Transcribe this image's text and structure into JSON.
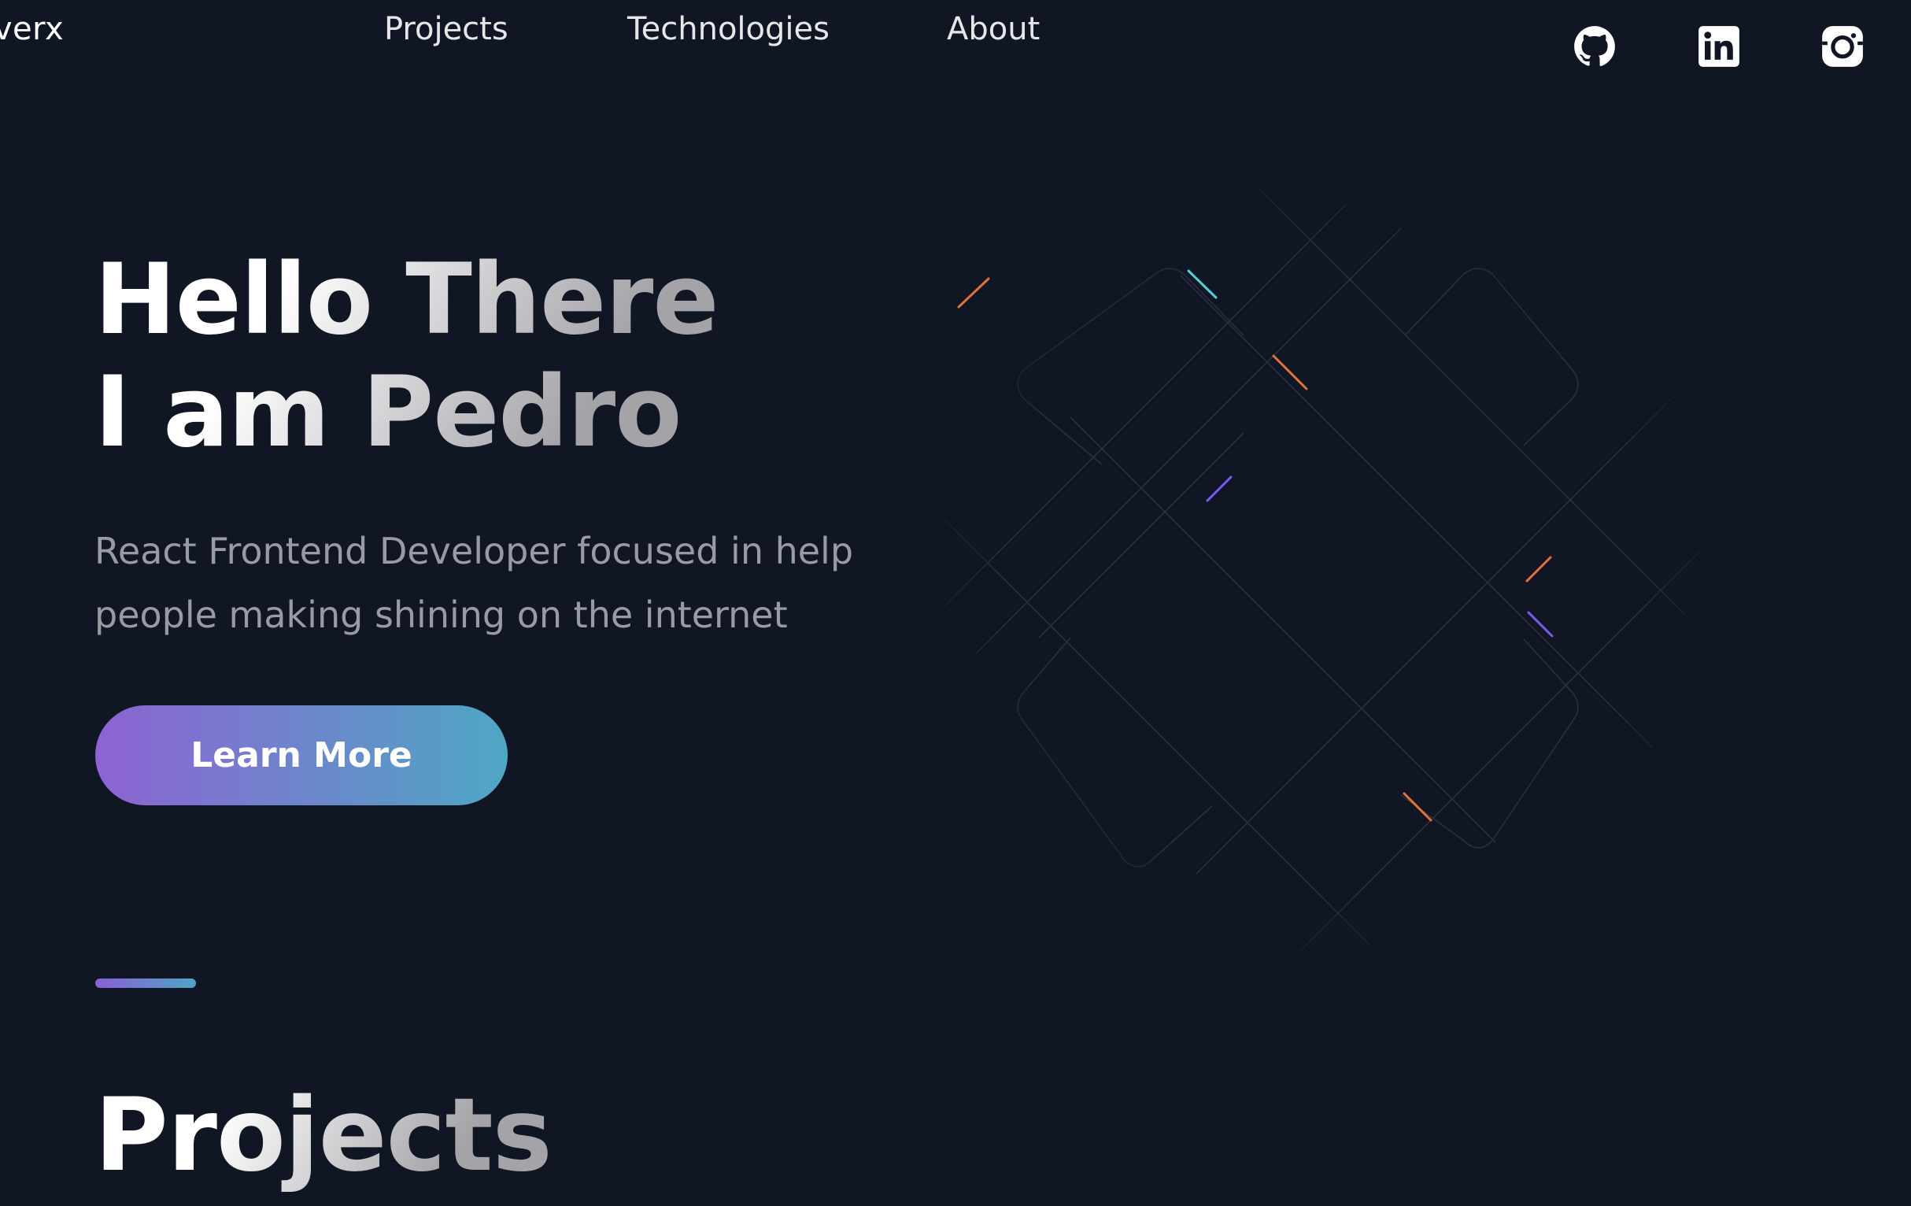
{
  "header": {
    "logo": "uverx",
    "nav": [
      {
        "label": "Projects"
      },
      {
        "label": "Technologies"
      },
      {
        "label": "About"
      }
    ],
    "social": [
      {
        "icon": "github-icon"
      },
      {
        "icon": "linkedin-icon"
      },
      {
        "icon": "instagram-icon"
      }
    ]
  },
  "hero": {
    "title_line1": "Hello There",
    "title_line2": "I am Pedro",
    "subtitle": "React Frontend Developer focused in help people making shining on the internet",
    "cta_label": "Learn More"
  },
  "projects": {
    "title": "Projects"
  },
  "colors": {
    "background": "#111624",
    "gradient_start": "#8d63d3",
    "gradient_end": "#4ea7c4",
    "subtitle_text": "#9a9aa3",
    "accent_orange": "#e0733a",
    "accent_purple": "#7b5cf0",
    "accent_cyan": "#4fd1d9"
  }
}
